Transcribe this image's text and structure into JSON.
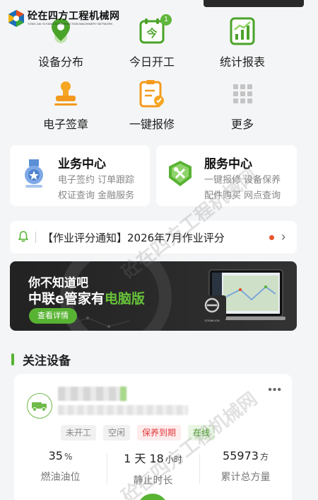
{
  "app": {
    "logo_cn": "砼在四方工程机械网",
    "logo_en": "TONG ZAI SI FANG CONSTRUCTION MACHINERY NETWORK"
  },
  "grid": [
    {
      "label": "设备分布",
      "icon": "device-distribution-icon"
    },
    {
      "label": "今日开工",
      "icon": "today-work-icon",
      "icon_text": "今",
      "badge": "1"
    },
    {
      "label": "统计报表",
      "icon": "statistics-report-icon"
    },
    {
      "label": "电子签章",
      "icon": "electronic-seal-icon"
    },
    {
      "label": "一键报修",
      "icon": "repair-report-icon"
    },
    {
      "label": "更多",
      "icon": "more-grid-icon"
    }
  ],
  "business_center": {
    "title": "业务中心",
    "line1": "电子签约 订单跟踪",
    "line2": "权证查询 金融服务"
  },
  "service_center": {
    "title": "服务中心",
    "line1": "一键报修 设备保养",
    "line2": "配件购买 网点查询"
  },
  "notice": {
    "text": "【作业评分通知】2026年7月作业评分"
  },
  "banner": {
    "line1": "你不知道吧",
    "line2_prefix": "中联e管家有",
    "line2_highlight": "电脑版",
    "button": "查看详情",
    "laptop_label": "ZOOMLION"
  },
  "section": {
    "title": "关注设备"
  },
  "equipment": {
    "more": "•••",
    "tags": [
      "未开工",
      "空闲",
      "保养到期",
      "在线"
    ],
    "stats": [
      {
        "value": "35",
        "unit": "%",
        "label": "燃油油位"
      },
      {
        "value": "1 天 18",
        "unit": "小时",
        "label": "静止时长"
      },
      {
        "value": "55973",
        "unit": "方",
        "label": "累计总方量"
      }
    ]
  },
  "watermark": "砼在四方工程机械网",
  "colors": {
    "accent": "#58b333",
    "orange": "#f39a1d",
    "notice_dot": "#e8542b"
  }
}
